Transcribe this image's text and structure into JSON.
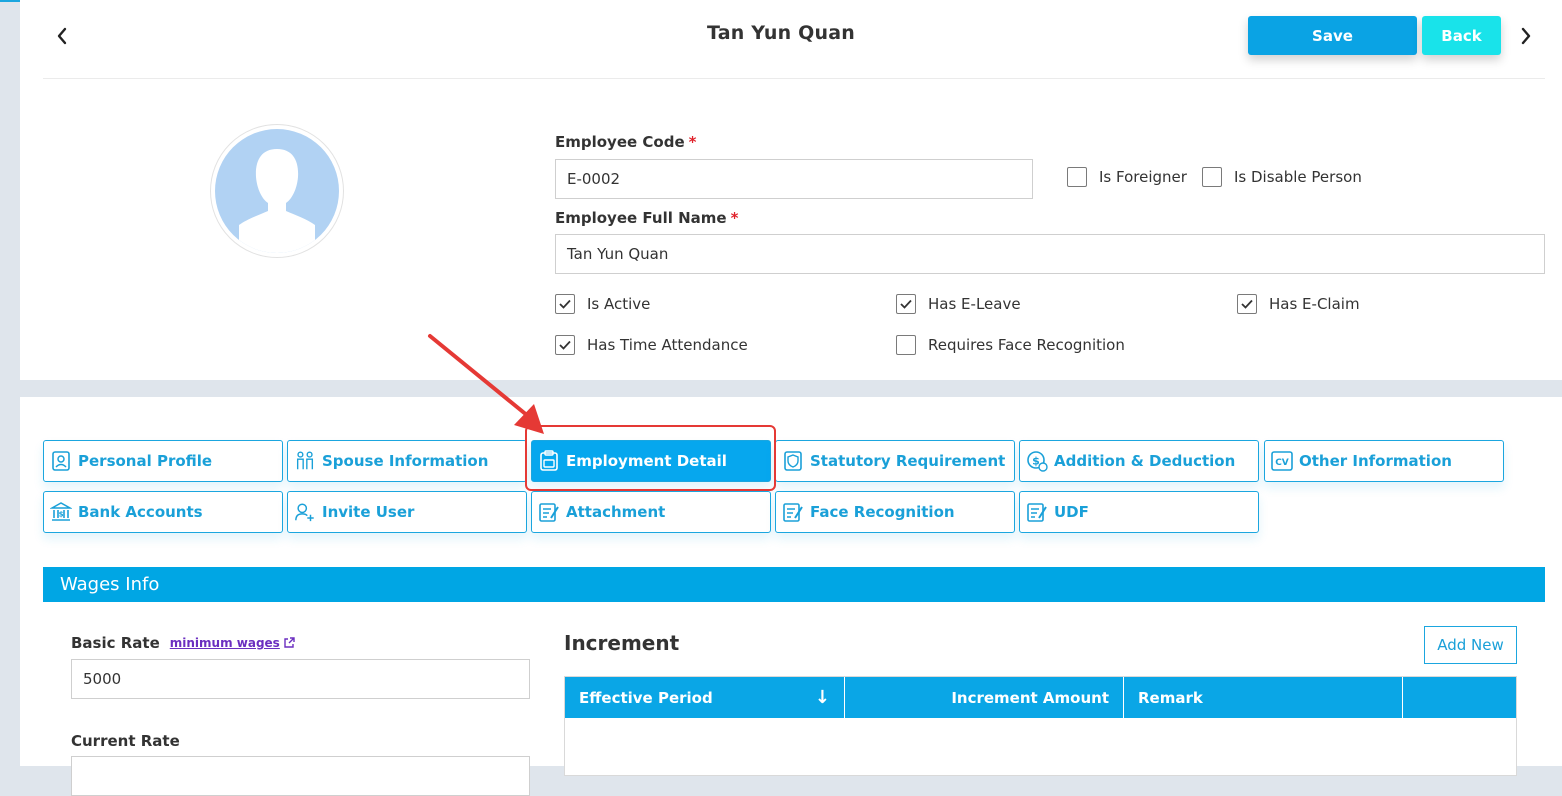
{
  "header": {
    "title": "Tan Yun Quan",
    "save_label": "Save",
    "back_label": "Back"
  },
  "form": {
    "employee_code_label": "Employee Code",
    "employee_code_value": "E-0002",
    "full_name_label": "Employee Full Name",
    "full_name_value": "Tan Yun Quan",
    "required_mark": "*",
    "checkboxes": {
      "is_foreigner": {
        "label": "Is Foreigner",
        "checked": false
      },
      "is_disable_person": {
        "label": "Is Disable Person",
        "checked": false
      },
      "is_active": {
        "label": "Is Active",
        "checked": true
      },
      "has_e_leave": {
        "label": "Has E-Leave",
        "checked": true
      },
      "has_e_claim": {
        "label": "Has E-Claim",
        "checked": true
      },
      "has_time_attendance": {
        "label": "Has Time Attendance",
        "checked": true
      },
      "requires_face_recognition": {
        "label": "Requires Face Recognition",
        "checked": false
      }
    }
  },
  "tabs": [
    {
      "label": "Personal Profile",
      "icon": "profile-badge-icon"
    },
    {
      "label": "Spouse Information",
      "icon": "couple-icon"
    },
    {
      "label": "Employment Detail",
      "icon": "briefcase-clipboard-icon",
      "active": true
    },
    {
      "label": "Statutory Requirement",
      "icon": "shield-document-icon"
    },
    {
      "label": "Addition & Deduction",
      "icon": "money-coin-icon"
    },
    {
      "label": "Other Information",
      "icon": "cv-icon"
    },
    {
      "label": "Bank Accounts",
      "icon": "bank-icon"
    },
    {
      "label": "Invite User",
      "icon": "add-user-icon"
    },
    {
      "label": "Attachment",
      "icon": "note-edit-icon"
    },
    {
      "label": "Face Recognition",
      "icon": "note-edit-icon"
    },
    {
      "label": "UDF",
      "icon": "note-edit-icon"
    }
  ],
  "wages": {
    "section_title": "Wages Info",
    "basic_rate_label": "Basic Rate",
    "minimum_wages_link": "minimum wages",
    "basic_rate_value": "5000",
    "current_rate_label": "Current Rate"
  },
  "increment": {
    "title": "Increment",
    "add_new_label": "Add New",
    "columns": [
      "Effective Period",
      "Increment Amount",
      "Remark",
      ""
    ],
    "sort_indicator": "↓"
  },
  "colors": {
    "accent": "#0aa3e4",
    "back_button": "#19e3ea",
    "highlight": "#e53935"
  }
}
